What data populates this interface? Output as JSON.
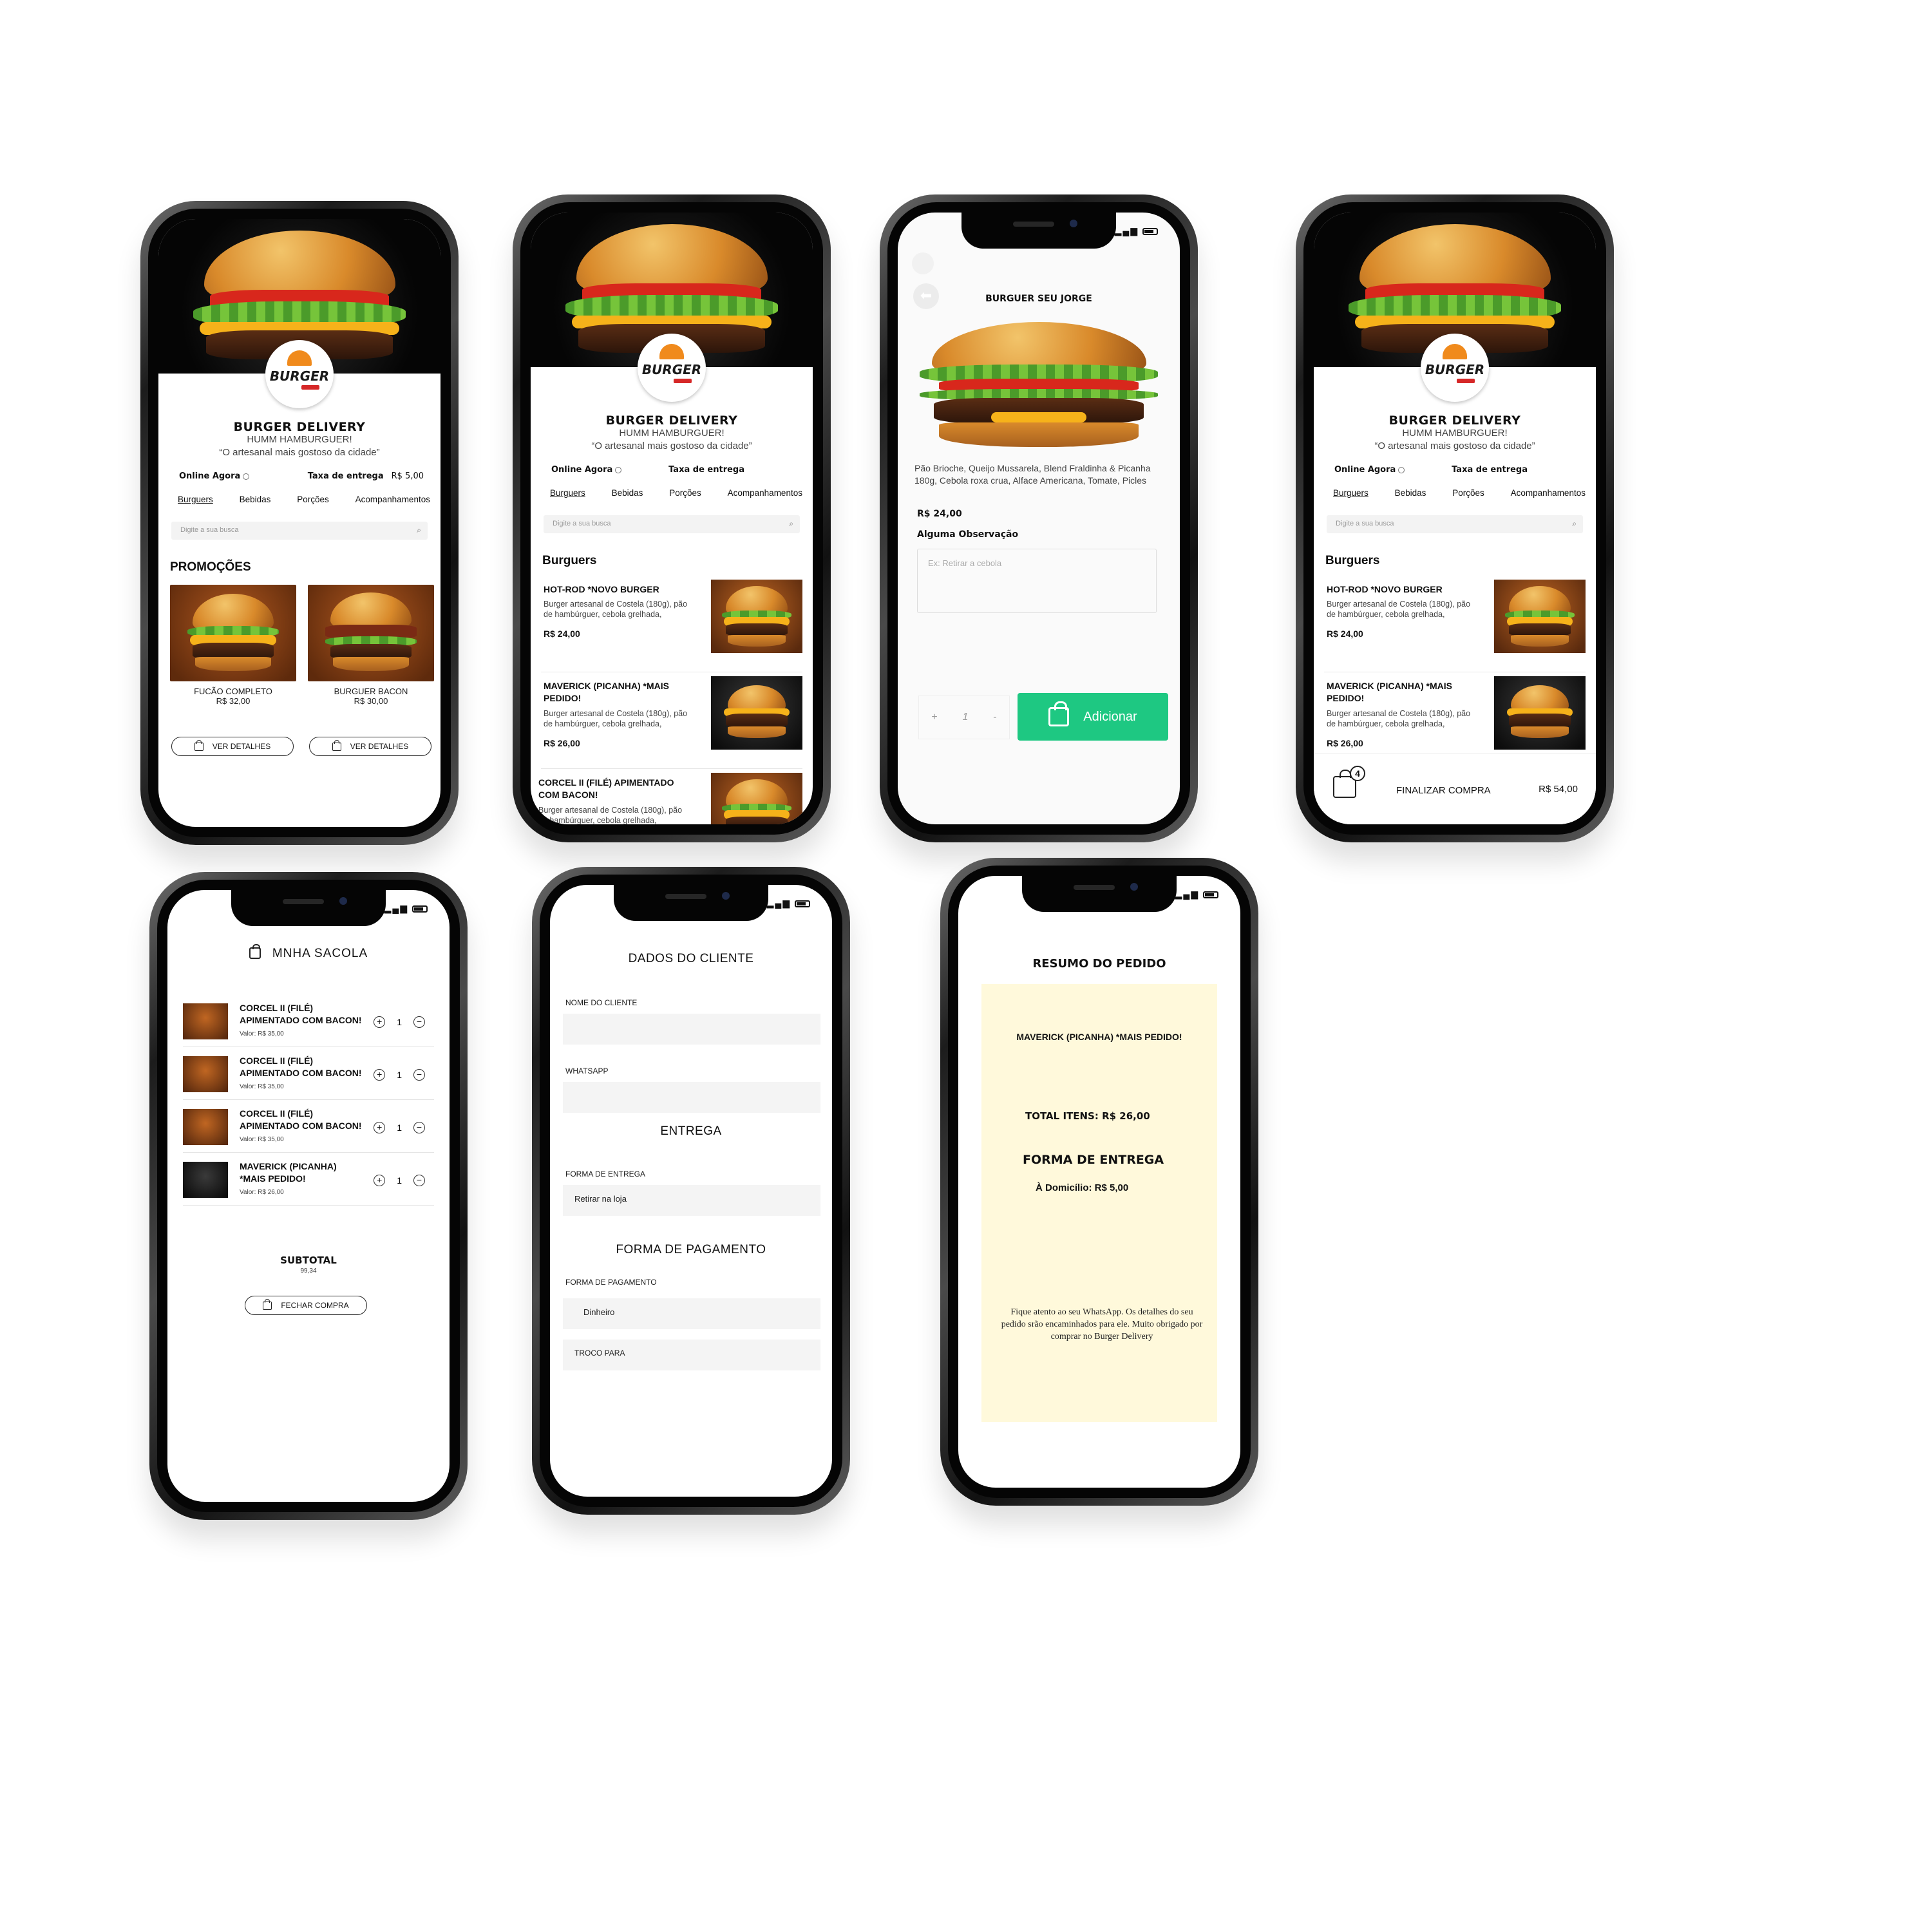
{
  "store": {
    "title": "BURGER DELIVERY",
    "subtitle": "HUMM HAMBURGUER!",
    "quote": "“O artesanal mais gostoso da cidade”",
    "logo_text": "BURGER",
    "online_label": "Online Agora",
    "fee_label": "Taxa de entrega",
    "fee_value": "R$ 5,00"
  },
  "tabs": [
    "Burguers",
    "Bebidas",
    "Porções",
    "Acompanhamentos"
  ],
  "search_placeholder": "Digite a sua busca",
  "promos": {
    "heading": "PROMOÇÕES",
    "items": [
      {
        "name": "FUCÃO COMPLETO",
        "price": "R$ 32,00",
        "button": "VER DETALHES"
      },
      {
        "name": "BURGUER BACON",
        "price": "R$ 30,00",
        "button": "VER DETALHES"
      }
    ]
  },
  "menu": {
    "heading": "Burguers",
    "items": [
      {
        "title": "HOT-ROD *NOVO BURGER",
        "desc": "Burger artesanal de Costela (180g), pão de hambúrguer, cebola grelhada,",
        "price": "R$ 24,00"
      },
      {
        "title": "MAVERICK (PICANHA) *MAIS PEDIDO!",
        "desc": "Burger artesanal de Costela (180g), pão de hambúrguer, cebola grelhada,",
        "price": "R$ 26,00"
      },
      {
        "title": "CORCEL II (FILÉ) APIMENTADO COM BACON!",
        "desc": "Burger artesanal de Costela (180g), pão de hambúrguer, cebola grelhada,",
        "price": ""
      }
    ]
  },
  "cart_bar": {
    "count": "4",
    "label": "FINALIZAR COMPRA",
    "total": "R$ 54,00"
  },
  "product": {
    "title": "BURGUER SEU JORGE",
    "desc": "Pão Brioche, Queijo Mussarela, Blend Fraldinha & Picanha 180g, Cebola roxa crua, Alface Americana, Tomate, Picles",
    "price": "R$ 24,00",
    "obs_label": "Alguma Observação",
    "obs_placeholder": "Ex: Retirar a cebola",
    "qty": "1",
    "plus": "+",
    "minus": "-",
    "add_label": "Adicionar"
  },
  "bag": {
    "title": "MNHA SACOLA",
    "lines": [
      {
        "name": "CORCEL II (FILÉ) APIMENTADO COM BACON!",
        "value": "Valor: R$ 35,00",
        "qty": "1"
      },
      {
        "name": "CORCEL II (FILÉ) APIMENTADO COM BACON!",
        "value": "Valor: R$ 35,00",
        "qty": "1"
      },
      {
        "name": "CORCEL II (FILÉ) APIMENTADO COM BACON!",
        "value": "Valor: R$ 35,00",
        "qty": "1"
      },
      {
        "name": "MAVERICK (PICANHA) *MAIS PEDIDO!",
        "value": "Valor: R$ 26,00",
        "qty": "1"
      }
    ],
    "subtotal_label": "SUBTOTAL",
    "subtotal_value": "99,34",
    "checkout_label": "FECHAR COMPRA"
  },
  "client_form": {
    "title": "DADOS DO CLIENTE",
    "name_label": "NOME DO CLIENTE",
    "whatsapp_label": "WHATSAPP",
    "delivery_title": "ENTREGA",
    "delivery_label": "FORMA DE ENTREGA",
    "delivery_value": "Retirar na loja",
    "payment_title": "FORMA DE PAGAMENTO",
    "payment_label": "FORMA DE PAGAMENTO",
    "payment_value": "Dinheiro",
    "change_label": "TROCO PARA"
  },
  "summary": {
    "title": "RESUMO DO PEDIDO",
    "item": "MAVERICK (PICANHA) *MAIS PEDIDO!",
    "total": "TOTAL ITENS: R$ 26,00",
    "delivery_title": "FORMA DE ENTREGA",
    "delivery_value": "À Domicílio: R$ 5,00",
    "note": "Fique atento ao seu WhatsApp. Os detalhes do seu pedido srão encaminhados para ele. Muito obrigado por comprar no Burger Delivery"
  },
  "colors": {
    "accent_green": "#1ec882",
    "logo_orange": "#f08a1c",
    "summary_bg": "#fff9db"
  }
}
